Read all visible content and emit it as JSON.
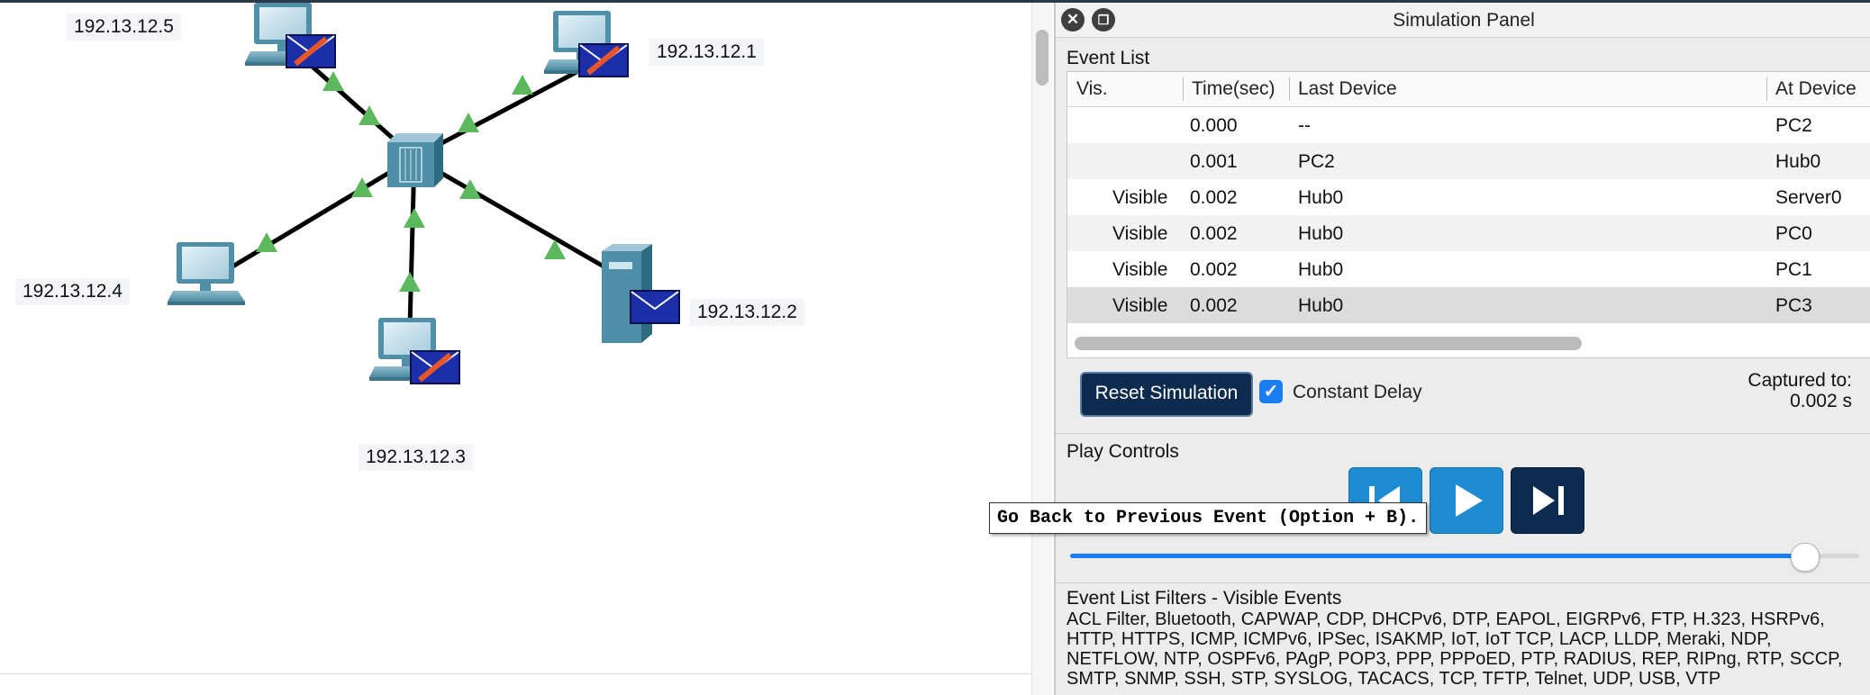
{
  "canvas": {
    "ip_pc_top_left": "192.13.12.5",
    "ip_pc_top_right": "192.13.12.1",
    "ip_pc_left": "192.13.12.4",
    "ip_server": "192.13.12.2",
    "ip_pc_bottom": "192.13.12.3"
  },
  "panel": {
    "title": "Simulation Panel",
    "event_list_title": "Event List",
    "columns": [
      "Vis.",
      "Time(sec)",
      "Last Device",
      "At Device"
    ],
    "rows": [
      {
        "vis": "",
        "time": "0.000",
        "last": "--",
        "at": "PC2"
      },
      {
        "vis": "",
        "time": "0.001",
        "last": "PC2",
        "at": "Hub0"
      },
      {
        "vis": "Visible",
        "time": "0.002",
        "last": "Hub0",
        "at": "Server0"
      },
      {
        "vis": "Visible",
        "time": "0.002",
        "last": "Hub0",
        "at": "PC0"
      },
      {
        "vis": "Visible",
        "time": "0.002",
        "last": "Hub0",
        "at": "PC1"
      },
      {
        "vis": "Visible",
        "time": "0.002",
        "last": "Hub0",
        "at": "PC3"
      }
    ],
    "reset_label": "Reset Simulation",
    "constant_delay_label": "Constant Delay",
    "constant_delay_checked": true,
    "captured_label": "Captured to:",
    "captured_value": "0.002 s",
    "play_controls_title": "Play Controls",
    "speed_slider_fraction": 0.93,
    "filters_title": "Event List Filters - Visible Events",
    "filters_text": "ACL Filter, Bluetooth, CAPWAP, CDP, DHCPv6, DTP, EAPOL, EIGRPv6, FTP, H.323, HSRPv6, HTTP, HTTPS, ICMP, ICMPv6, IPSec, ISAKMP, IoT, IoT TCP, LACP, LLDP, Meraki, NDP, NETFLOW, NTP, OSPFv6, PAgP, POP3, PPP, PPPoED, PTP, RADIUS, REP, RIPng, RTP, SCCP, SMTP, SNMP, SSH, STP, SYSLOG, TACACS, TCP, TFTP, Telnet, UDP, USB, VTP"
  },
  "tooltip": "Go Back to Previous Event (Option + B).",
  "icons": {
    "close": "close-icon",
    "restore": "restore-window-icon",
    "back": "step-back-icon",
    "play": "play-icon",
    "forward": "step-forward-icon"
  },
  "colors": {
    "link_arrow": "#5cb85c",
    "envelope": "#1d2fa8",
    "device": "#4f8fa7",
    "reset_button": "#0c2b4e",
    "play_button": "#1f8bd0",
    "accent": "#1a7ef0"
  }
}
